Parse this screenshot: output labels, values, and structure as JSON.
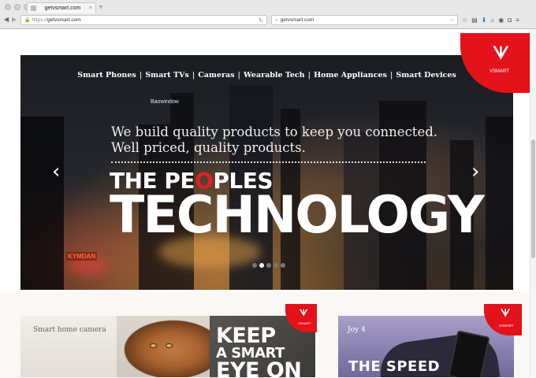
{
  "browser": {
    "tab_title": "getvsmart.com",
    "tab_close": "×",
    "new_tab": "+",
    "url_scheme": "https://",
    "url_host": "getvsmart.com",
    "reload_icon": "↻",
    "search_text": "getvsmart.com",
    "search_go": "→",
    "back": "◀",
    "forward": "▶",
    "toolbar_icons": [
      "star-icon",
      "reading-list-icon",
      "download-icon",
      "home-icon",
      "pocket-icon",
      "shield-icon",
      "menu-icon"
    ]
  },
  "hero": {
    "menu": [
      "Smart Phones",
      "Smart TVs",
      "Cameras",
      "Wearable Tech",
      "Home Appliances",
      "Smart Devices"
    ],
    "separator": "|",
    "tagline_1": "We build quality products to keep you connected.",
    "tagline_2": "Well priced, quality products.",
    "headline_1_pre": "THE PE",
    "headline_1_hl": "O",
    "headline_1_post": "PLES",
    "headline_2": "TECHNOLOGY",
    "prev_arrow": "‹",
    "next_arrow": "›",
    "city_sign_1": "KYMDAN",
    "city_sign_2": "Baowindow",
    "slides_total": 5,
    "slide_active": 2
  },
  "brand": {
    "wordmark": "VSMART",
    "logo_glyph": "ᗐ",
    "color": "#e4121a"
  },
  "cards": [
    {
      "label": "Smart home camera",
      "headline_1": "KEEP",
      "headline_2": "A SMART",
      "headline_3": "EYE ON"
    },
    {
      "label": "Joy 4",
      "headline": "THE SPEED"
    }
  ]
}
